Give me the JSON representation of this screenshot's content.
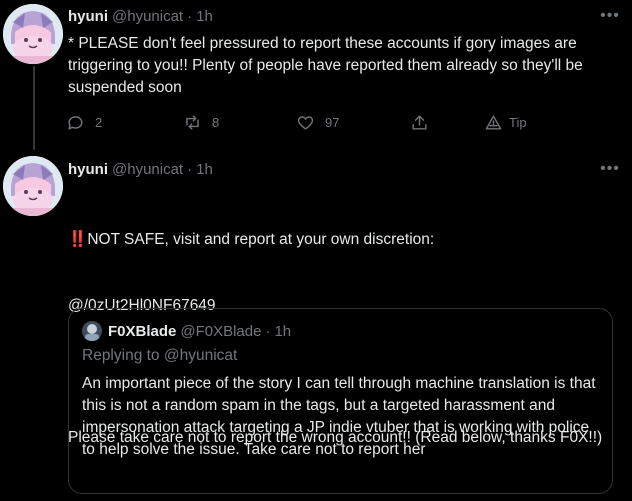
{
  "tweets": [
    {
      "name": "hyuni",
      "handle": "@hyunicat",
      "dot": "·",
      "time": "1h",
      "text": "* PLEASE don't feel pressured to report these accounts if gory images are triggering to you!! Plenty of people have reported them already so they'll be suspended soon",
      "actions": {
        "replies": "2",
        "retweets": "8",
        "likes": "97",
        "tip": "Tip"
      }
    },
    {
      "name": "hyuni",
      "handle": "@hyunicat",
      "dot": "·",
      "time": "1h",
      "emoji": "‼️",
      "text_line1": "NOT SAFE, visit and report at your own discretion:",
      "text_line2": "@/0zUt2Hl0NF67649",
      "text_para2": "Please take care not to report the wrong account!! (Read below, thanks F0X!!)",
      "quote": {
        "name": "F0XBlade",
        "handle": "@F0XBlade",
        "dot": "·",
        "time": "1h",
        "replying": "Replying to @hyunicat",
        "text": "An important piece of the story I can tell through machine translation is that this is not a random spam in the tags, but a targeted harassment and impersonation attack targeting a JP indie vtuber that is working with police to help solve the issue. Take care not to report her"
      }
    }
  ],
  "icons": [
    "more-icon",
    "reply-icon",
    "retweet-icon",
    "like-icon",
    "share-icon",
    "tip-icon"
  ],
  "colors": {
    "background": "#000000",
    "text": "#e7e9ea",
    "muted": "#71767b",
    "border": "#2f3336"
  }
}
